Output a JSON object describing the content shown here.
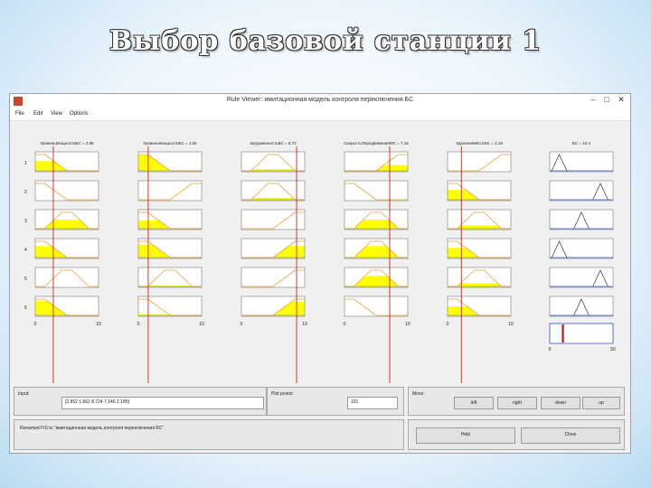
{
  "slide": {
    "title": "Выбор базовой станции 1"
  },
  "window": {
    "title": "Rule Viewer: имитационная модель контроля переключения БС",
    "controls": {
      "minimize": "–",
      "maximize": "□",
      "close": "✕"
    },
    "app_icon": "matlab-icon"
  },
  "menu": [
    "File",
    "Edit",
    "View",
    "Options"
  ],
  "rule_viewer": {
    "inputs": [
      {
        "label": "УровеньМощностиБС = 2.85",
        "value": 2.852,
        "range": [
          0,
          10
        ],
        "range_labels": [
          "0",
          "10"
        ],
        "mf": [
          "left",
          "left",
          "center",
          "left",
          "center",
          "left"
        ],
        "fill": [
          0.6,
          0.0,
          0.55,
          0.7,
          0.0,
          0.9
        ]
      },
      {
        "label": "УровеньМощностиБС = 1.56",
        "value": 1.562,
        "range": [
          0,
          10
        ],
        "range_labels": [
          "0",
          "10"
        ],
        "mf": [
          "left",
          "right",
          "left",
          "left",
          "center",
          "left"
        ],
        "fill": [
          0.95,
          0.0,
          0.5,
          0.8,
          0.05,
          0.05
        ]
      },
      {
        "label": "ЗагруженностьБС = 8.72",
        "value": 8.724,
        "range": [
          0,
          10
        ],
        "range_labels": [
          "0",
          "10"
        ],
        "mf": [
          "center",
          "center",
          "right",
          "right",
          "right",
          "right"
        ],
        "fill": [
          0.1,
          0.12,
          0.0,
          0.7,
          0.0,
          0.85
        ]
      },
      {
        "label": "СкоростьПередвиженияМС = 7.15",
        "value": 7.146,
        "range": [
          0,
          10
        ],
        "range_labels": [
          "0",
          "10"
        ],
        "mf": [
          "right",
          "left",
          "center",
          "center",
          "center",
          "left"
        ],
        "fill": [
          0.35,
          0.0,
          0.55,
          0.7,
          0.65,
          0.0
        ]
      },
      {
        "label": "УдалениеМСотБС = 2.19",
        "value": 2.185,
        "range": [
          0,
          10
        ],
        "range_labels": [
          "0",
          "10"
        ],
        "mf": [
          "right",
          "left",
          "center",
          "left",
          "center",
          "left"
        ],
        "fill": [
          0.0,
          0.6,
          0.2,
          0.6,
          0.2,
          0.55
        ]
      }
    ],
    "output": {
      "label": "БС = 10.4",
      "value": 10.4,
      "range": [
        0,
        50
      ],
      "range_labels": [
        "0",
        "50"
      ],
      "mf": [
        "tri-left",
        "tri-right",
        "tri-mid",
        "tri-left",
        "tri-right",
        "tri-mid"
      ]
    },
    "rule_numbers": [
      "1",
      "2",
      "3",
      "4",
      "5",
      "6"
    ]
  },
  "colors": {
    "fill": "#ffff00",
    "line": "#f0a030",
    "cursor": "#d02020",
    "output_marker": "#d02020"
  },
  "bottom": {
    "input_label": "Input:",
    "input_value": "[2.852 1.562 8.724 7.146 2.185]",
    "plot_points_label": "Plot points:",
    "plot_points_value": "101",
    "move_label": "Move:",
    "buttons": {
      "left": "left",
      "right": "right",
      "down": "down",
      "up": "up",
      "help": "Help",
      "close": "Close"
    },
    "status": "Renamed FIS to \"имитационная модель контроля переключения БС\""
  }
}
